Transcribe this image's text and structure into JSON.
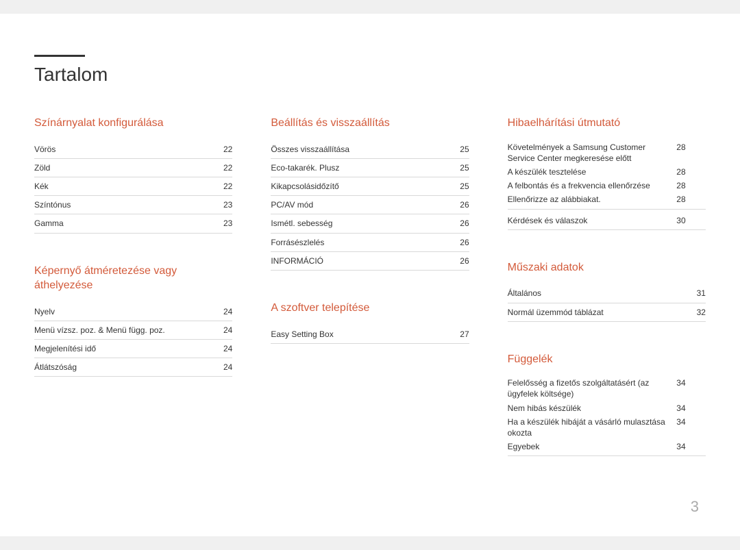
{
  "title": "Tartalom",
  "page_number": "3",
  "columns": [
    {
      "sections": [
        {
          "heading": "Színárnyalat konfigurálása",
          "rows": [
            {
              "label": "Vörös",
              "page": "22"
            },
            {
              "label": "Zöld",
              "page": "22"
            },
            {
              "label": "Kék",
              "page": "22"
            },
            {
              "label": "Színtónus",
              "page": "23"
            },
            {
              "label": "Gamma",
              "page": "23"
            }
          ]
        },
        {
          "heading": "Képernyő átméretezése vagy áthelyezése",
          "rows": [
            {
              "label": "Nyelv",
              "page": "24"
            },
            {
              "label": "Menü vízsz. poz. & Menü függ. poz.",
              "page": "24"
            },
            {
              "label": "Megjelenítési idő",
              "page": "24"
            },
            {
              "label": "Átlátszóság",
              "page": "24"
            }
          ]
        }
      ]
    },
    {
      "sections": [
        {
          "heading": "Beállítás és visszaállítás",
          "rows": [
            {
              "label": "Összes visszaállítása",
              "page": "25"
            },
            {
              "label": "Eco-takarék. Plusz",
              "page": "25"
            },
            {
              "label": "Kikapcsolásidőzítő",
              "page": "25"
            },
            {
              "label": "PC/AV mód",
              "page": "26"
            },
            {
              "label": "Ismétl. sebesség",
              "page": "26"
            },
            {
              "label": "Forrásészlelés",
              "page": "26"
            },
            {
              "label": "INFORMÁCIÓ",
              "page": "26"
            }
          ]
        },
        {
          "heading": "A szoftver telepítése",
          "rows": [
            {
              "label": "Easy Setting Box",
              "page": "27"
            }
          ]
        }
      ]
    },
    {
      "sections": [
        {
          "heading": "Hibaelhárítási útmutató",
          "groups": [
            {
              "rows": [
                {
                  "label": "Követelmények a Samsung Customer Service Center megkeresése előtt",
                  "page": "28"
                },
                {
                  "label": "A készülék tesztelése",
                  "page": "28"
                },
                {
                  "label": "A felbontás és a frekvencia ellenőrzése",
                  "page": "28"
                },
                {
                  "label": "Ellenőrizze az alábbiakat.",
                  "page": "28"
                }
              ]
            },
            {
              "rows": [
                {
                  "label": "Kérdések és válaszok",
                  "page": "30"
                }
              ]
            }
          ]
        },
        {
          "heading": "Műszaki adatok",
          "rows": [
            {
              "label": "Általános",
              "page": "31"
            },
            {
              "label": "Normál üzemmód táblázat",
              "page": "32"
            }
          ]
        },
        {
          "heading": "Függelék",
          "groups": [
            {
              "rows": [
                {
                  "label": "Felelősség a fizetős szolgáltatásért (az ügyfelek költsége)",
                  "page": "34"
                },
                {
                  "label": "Nem hibás készülék",
                  "page": "34"
                },
                {
                  "label": "Ha a készülék hibáját a vásárló mulasztása okozta",
                  "page": "34"
                },
                {
                  "label": "Egyebek",
                  "page": "34"
                }
              ]
            }
          ]
        }
      ]
    }
  ]
}
